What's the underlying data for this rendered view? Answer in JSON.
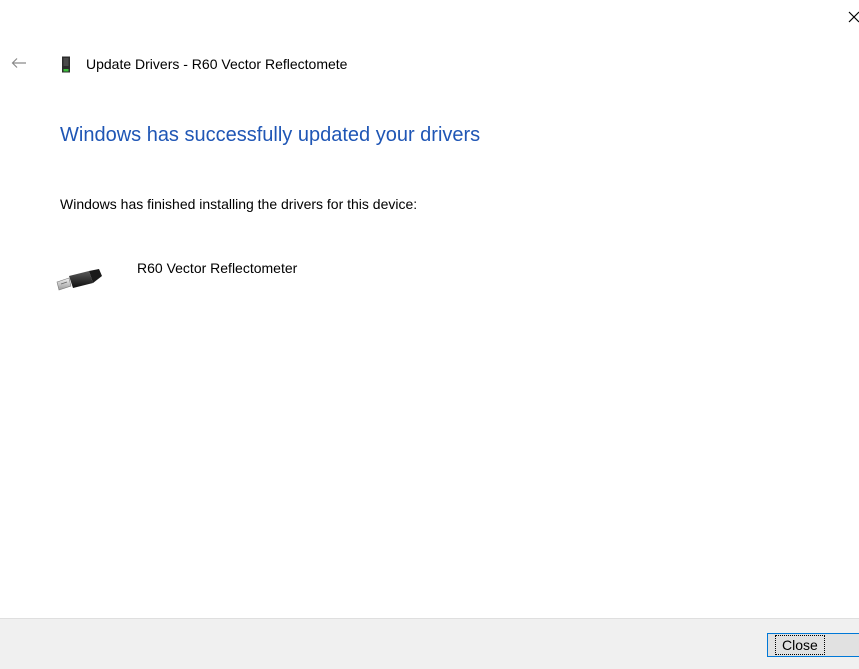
{
  "window": {
    "title": "Update Drivers - R60 Vector Reflectomete",
    "close_glyph": "×",
    "back_icon": "back-arrow-icon",
    "title_icon": "device-manager-icon"
  },
  "main": {
    "headline": "Windows has successfully updated your drivers",
    "description": "Windows has finished installing the drivers for this device:",
    "device": {
      "name": "R60 Vector Reflectometer",
      "icon": "usb-plug-icon"
    }
  },
  "footer": {
    "close_label": "Close"
  },
  "colors": {
    "headline": "#1f56b5",
    "footer_bg": "#f0f0f0",
    "button_border": "#0078d7"
  }
}
